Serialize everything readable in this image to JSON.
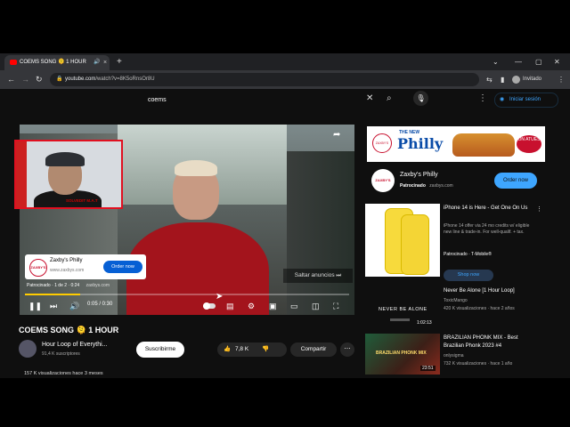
{
  "browser": {
    "tab_title": "COEMS SONG 🫠 1 HOUR",
    "tab_close": "×",
    "new_tab": "+",
    "window_controls": [
      "⌄",
      "—",
      "▢",
      "✕"
    ],
    "url_domain": "youtube.com",
    "url_path": "/watch?v=8K5oRnsOr8U",
    "profile_label": "Invitado"
  },
  "youtube": {
    "search_query": "coems",
    "sign_in": "Iniciar sesión"
  },
  "video": {
    "ad_name": "Zaxby's Philly",
    "ad_domain": "www.zaxbys.com",
    "ad_button": "Order now",
    "ad_logo": "ZAXBY'S",
    "ad_sponsor": "Patrocinado · 1 de 2 · 0:24",
    "ad_domain_short": "zaxbys.com",
    "skip_label": "Saltar anuncios ⏭",
    "time": "0:05 / 0:30",
    "progress": 0.17,
    "title": "COEMS SONG 🫠 1 HOUR",
    "channel": "Hour Loop of Everythi...",
    "subscribers": "91,4 K suscriptores",
    "subscribe": "Suscribirme",
    "likes": "7,8 K",
    "share": "Compartir",
    "views": "157 K visualizaciones  hace 3 meses"
  },
  "webcam": {
    "caption": "SOLVEDIT  M.A.T"
  },
  "sidebar": {
    "banner": {
      "small": "THE NEW",
      "big": "Philly",
      "tag": "ON ATUES"
    },
    "ad": {
      "name": "Zaxby's Philly",
      "sponsor": "Patrocinado",
      "domain": "zaxbys.com",
      "button": "Order now"
    },
    "items": [
      {
        "title": "iPhone 14 is Here - Get One On Us",
        "meta": "iPhone 14 offer via 24 mo credits w/ eligible new line & trade-in. For well-qualif. + tax.",
        "channel": "Patrocinado · T-Mobile®",
        "button": "Shop now"
      },
      {
        "title": "Never Be Alone [1 Hour Loop]",
        "meta": "ToxicMango",
        "stats": "420 K visualizaciones · hace 2 años",
        "thumb_text": "NEVER BE ALONE",
        "duration": "1:02:13"
      },
      {
        "title": "BRAZILIAN PHONK MIX - Best Brazilian Phonk 2023 #4",
        "meta": "onlysigma",
        "stats": "732 K visualizaciones · hace 1 año",
        "thumb_text": "BRAZILIAN PHONK MIX",
        "duration": "23:51"
      }
    ]
  }
}
